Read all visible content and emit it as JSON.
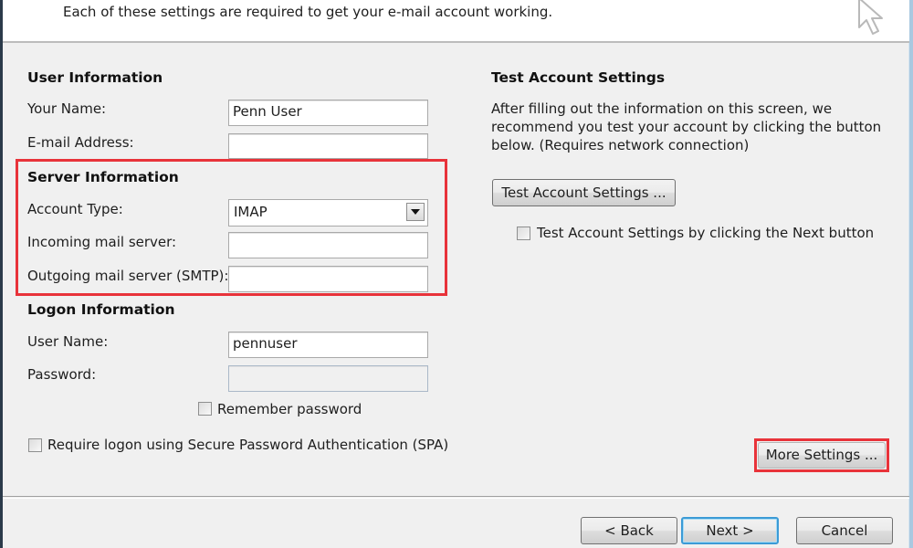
{
  "header": {
    "instruction": "Each of these settings are required to get your e-mail account working."
  },
  "user_info": {
    "title": "User Information",
    "your_name_label": "Your Name:",
    "your_name_value": "Penn User",
    "email_label": "E-mail Address:",
    "email_value": ""
  },
  "server_info": {
    "title": "Server Information",
    "account_type_label": "Account Type:",
    "account_type_value": "IMAP",
    "incoming_label": "Incoming mail server:",
    "incoming_value": "",
    "outgoing_label": "Outgoing mail server (SMTP):",
    "outgoing_value": ""
  },
  "logon_info": {
    "title": "Logon Information",
    "user_name_label": "User Name:",
    "user_name_value": "pennuser",
    "password_label": "Password:",
    "password_value": "",
    "remember_password_label": "Remember password",
    "remember_password_checked": false,
    "spa_label": "Require logon using Secure Password Authentication (SPA)",
    "spa_checked": false
  },
  "test_settings": {
    "title": "Test Account Settings",
    "description_line1": "After filling out the information on this screen, we",
    "description_line2": "recommend you test your account by clicking the button",
    "description_line3": "below. (Requires network connection)",
    "test_button": "Test Account Settings ...",
    "test_on_next_label": "Test Account Settings by clicking the Next button",
    "test_on_next_checked": false
  },
  "more_settings_button": "More Settings ...",
  "footer": {
    "back_button": "< Back",
    "next_button": "Next >",
    "cancel_button": "Cancel"
  },
  "highlight_color": "#e8333a",
  "focus_color": "#3c9bd6"
}
